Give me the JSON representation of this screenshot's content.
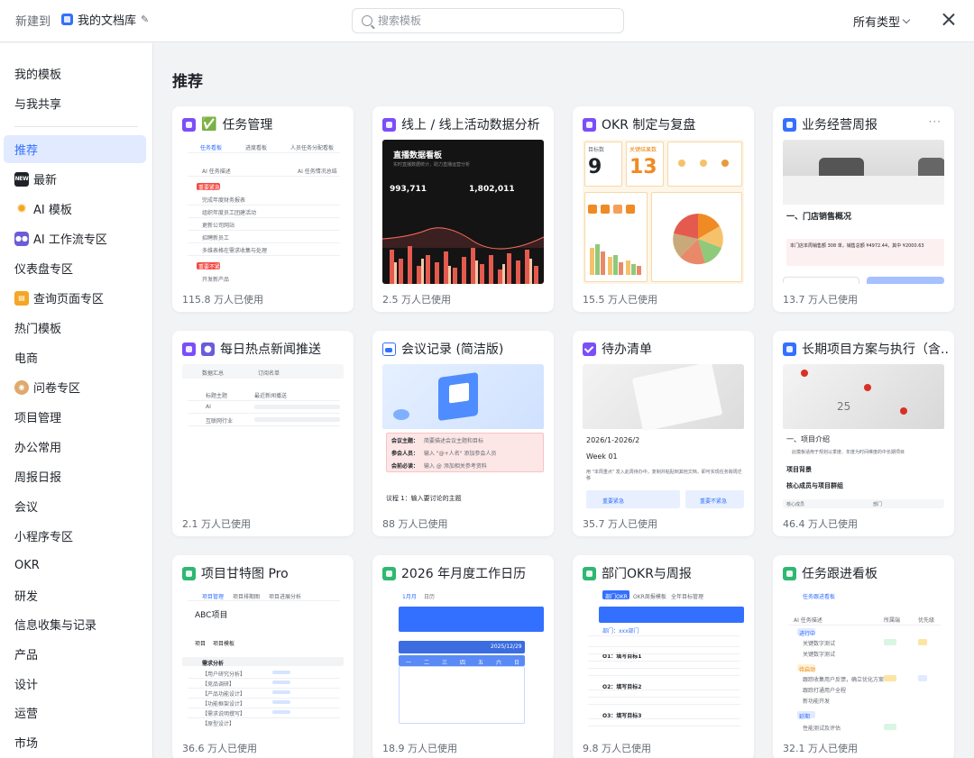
{
  "header": {
    "new_label": "新建到",
    "library_name": "我的文档库",
    "search_placeholder": "搜索模板",
    "type_filter": "所有类型"
  },
  "sidebar": {
    "top_items": [
      {
        "label": "我的模板"
      },
      {
        "label": "与我共享"
      }
    ],
    "items": [
      {
        "label": "推荐",
        "active": true
      },
      {
        "label": "最新",
        "icon": "new-badge-icon"
      },
      {
        "label": "AI 模板",
        "icon": "sparkle-icon"
      },
      {
        "label": "AI 工作流专区",
        "icon": "robot-icon"
      },
      {
        "label": "仪表盘专区"
      },
      {
        "label": "查询页面专区",
        "icon": "book-icon"
      },
      {
        "label": "热门模板"
      },
      {
        "label": "电商"
      },
      {
        "label": "问卷专区",
        "icon": "person-icon"
      },
      {
        "label": "项目管理"
      },
      {
        "label": "办公常用"
      },
      {
        "label": "周报日报"
      },
      {
        "label": "会议"
      },
      {
        "label": "小程序专区"
      },
      {
        "label": "OKR"
      },
      {
        "label": "研发"
      },
      {
        "label": "信息收集与记录"
      },
      {
        "label": "产品"
      },
      {
        "label": "设计"
      },
      {
        "label": "运营"
      },
      {
        "label": "市场"
      }
    ]
  },
  "main": {
    "section_title": "推荐",
    "cards": [
      {
        "title": "任务管理",
        "emoji": "✅",
        "usage": "115.8 万人已使用"
      },
      {
        "title": "线上 / 线上活动数据分析",
        "usage": "2.5 万人已使用"
      },
      {
        "title": "OKR 制定与复盘",
        "usage": "15.5 万人已使用"
      },
      {
        "title": "业务经营周报",
        "usage": "13.7 万人已使用",
        "more": "···"
      },
      {
        "title": "每日热点新闻推送",
        "usage": "2.1 万人已使用"
      },
      {
        "title": "会议记录 (简洁版)",
        "usage": "88 万人已使用"
      },
      {
        "title": "待办清单",
        "usage": "35.7 万人已使用"
      },
      {
        "title": "长期项目方案与执行（含...",
        "usage": "46.4 万人已使用"
      },
      {
        "title": "项目甘特图 Pro",
        "usage": "36.6 万人已使用"
      },
      {
        "title": "2026 年月度工作日历",
        "usage": "18.9 万人已使用"
      },
      {
        "title": "部门OKR与周报",
        "usage": "9.8 万人已使用"
      },
      {
        "title": "任务跟进看板",
        "usage": "32.1 万人已使用"
      }
    ],
    "previews": {
      "task": {
        "tab1": "任务看板",
        "tab2": "进度看板",
        "tab3": "人员任务分配看板",
        "col1": "AI 任务描述",
        "col2": "AI 任务情况总结",
        "group1": "重要紧急",
        "group2": "重要不紧急",
        "rows": [
          "完成年度财务报表",
          "组织年度员工团建活动",
          "更新公司网站",
          "招聘新员工",
          "多维表格在需求收集与处理"
        ],
        "rows2": [
          "开发新产品"
        ]
      },
      "activity": {
        "title": "直播数据看板",
        "subtitle": "实时直播数据统计，助力直播运营分析",
        "n1": "993,711",
        "n2": "1,802,011"
      },
      "okr": {
        "n1": "9",
        "n2": "13",
        "l1": "目标数",
        "l2": "关键结果数"
      },
      "weekly": {
        "heading": "一、门店销售概况",
        "line": "本门店本周销售额 308 单，销售总额 ¥4972.44，其中 ¥2000.63",
        "use_btn": "使用",
        "preview_btn": "预览"
      },
      "news": {
        "tab1": "数据汇总",
        "tab2": "订阅名单",
        "col1": "标题主题",
        "col2": "最近新闻播送",
        "r1": "AI",
        "r2": "互联网行业"
      },
      "meeting": {
        "f1": "会议主题：",
        "f1v": "简要描述会议主题和目标",
        "f2": "参会人员：",
        "f2v": "输入 \"@+人名\" 添加参会人员",
        "f3": "会前必读：",
        "f3v": "输入 @ 添加相关参考资料",
        "agenda": "议程 1：输入要讨论的主题"
      },
      "todo": {
        "range": "2026/1-2026/2",
        "week": "Week 01",
        "note": "用 \"本周重点\" 发入此周待办中，复制并粘贴到其他文档，即可实现任务跨周迁移",
        "b1": "重要紧急",
        "b2": "重要不紧急"
      },
      "longterm": {
        "h1": "一、项目介绍",
        "p": "此模板适用于规划以季度、年度为时间维度的中长期项目",
        "h2": "项目背景",
        "h3": "核心成员与项目群组",
        "c1": "核心成员",
        "c2": "部门"
      },
      "gantt": {
        "tab1": "项目管理",
        "tab2": "项目排期图",
        "tab3": "项目进展分析",
        "project": "ABC项目",
        "c1": "项目",
        "c2": "项目模板",
        "sec": "需求分析",
        "rows": [
          "【用户研究分析】",
          "【竞品调研】",
          "【产品功能设计】",
          "【功能框架设计】",
          "【需求说明撰写】",
          "【原型设计】",
          "【交互设计】"
        ]
      },
      "calendar": {
        "tab1": "1月月",
        "tab2": "日历",
        "date": "2025/12/29",
        "days": [
          "一",
          "二",
          "三",
          "四",
          "五",
          "六",
          "日"
        ]
      },
      "deptokr": {
        "tab1": "部门OKR",
        "tab2": "OKR周报模板",
        "tab3": "全年目标管理",
        "dept": "部门：xxx部门",
        "o1": "O1：填写目标1",
        "o2": "O2：填写目标2",
        "o3": "O3：填写目标3"
      },
      "kanban": {
        "tab": "任务跟进看板",
        "col1": "AI 任务描述",
        "col2": "所属端",
        "col3": "优先级",
        "g1": "进行中",
        "g2": "待启动",
        "g3": "延期",
        "rows": [
          "关键数字测试",
          "关键数字测试",
          "跟踪收集用户反馈，确立优化方案",
          "跟踪打通用户全程",
          "新功能开发"
        ],
        "rows2": [
          "性能测试及评估"
        ]
      }
    }
  },
  "colors": {
    "accent": "#3370ff",
    "active_bg": "#e1eaff"
  }
}
